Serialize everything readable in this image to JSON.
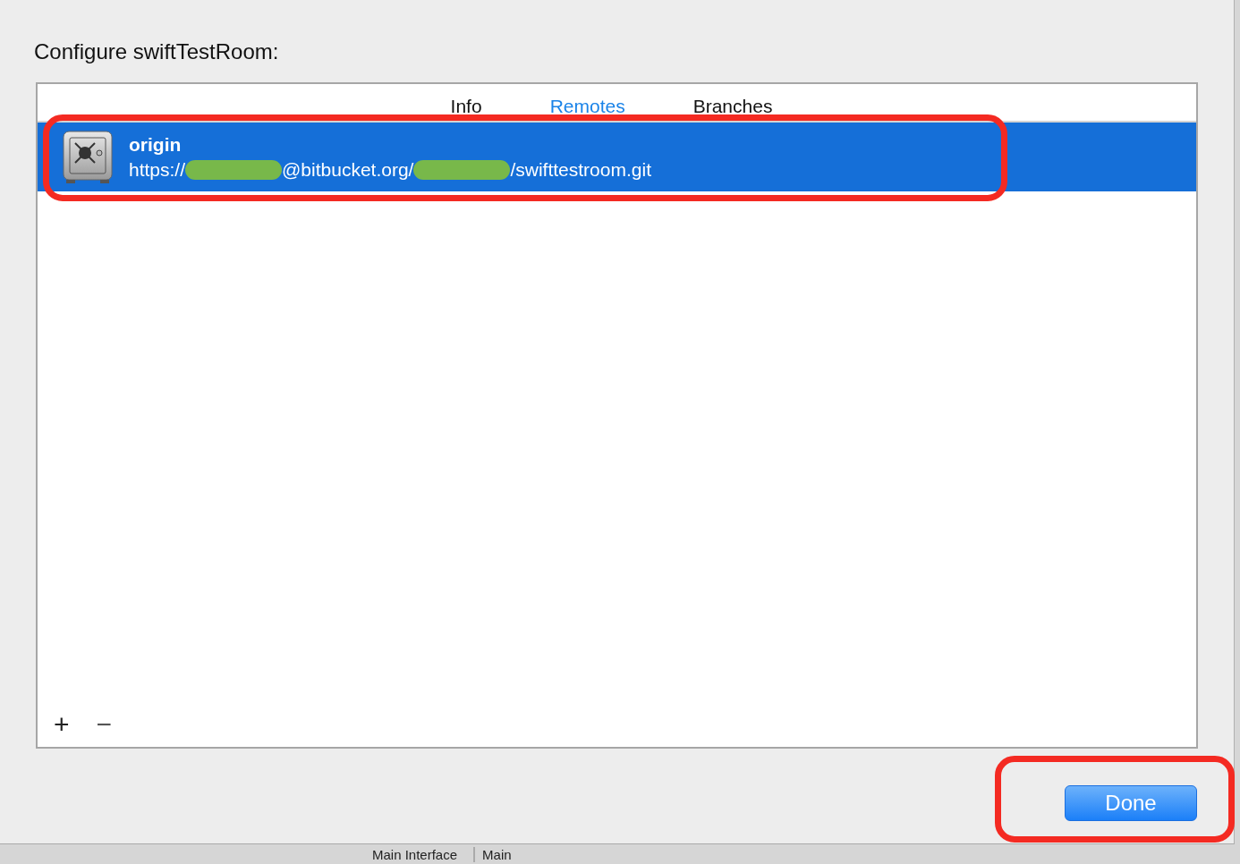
{
  "dialog": {
    "title": "Configure swiftTestRoom:",
    "tabs": [
      {
        "label": "Info",
        "selected": false
      },
      {
        "label": "Remotes",
        "selected": true
      },
      {
        "label": "Branches",
        "selected": false
      }
    ],
    "remotes": [
      {
        "name": "origin",
        "selected": true,
        "highlighted": true,
        "url_parts": [
          {
            "kind": "text",
            "text": "https://"
          },
          {
            "kind": "redacted"
          },
          {
            "kind": "text",
            "text": "@bitbucket.org/"
          },
          {
            "kind": "redacted"
          },
          {
            "kind": "text",
            "text": "/swifttestroom.git"
          }
        ]
      }
    ],
    "add_button": "+",
    "remove_button": "−",
    "done_button": {
      "label": "Done",
      "highlighted": true
    }
  },
  "background": {
    "label": "Main Interface",
    "value": "Main"
  }
}
